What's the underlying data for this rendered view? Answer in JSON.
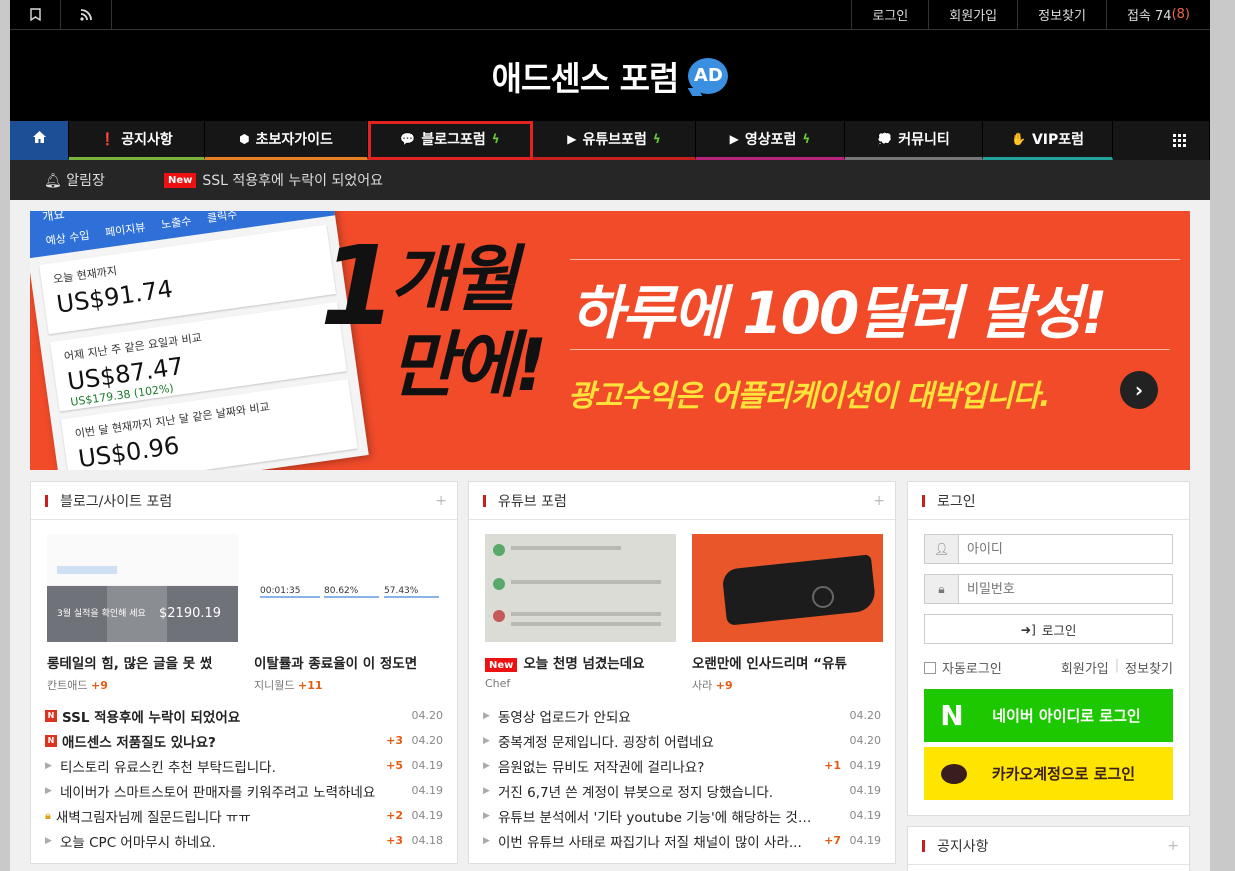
{
  "topbar": {
    "links": [
      "로그인",
      "회원가입",
      "정보찾기"
    ],
    "visitors_label": "접속 74",
    "visitors_new": "(8)"
  },
  "header": {
    "title": "애드센스 포럼",
    "badge": "AD"
  },
  "nav": {
    "items": [
      {
        "label": "공지사항",
        "icon": "info-icon",
        "color": "#7bb33a"
      },
      {
        "label": "초보자가이드",
        "icon": "cube-icon",
        "color": "#e67e22"
      },
      {
        "label": "블로그포럼",
        "icon": "chat-icon",
        "color": "#2a5db0"
      },
      {
        "label": "유튜브포럼",
        "icon": "youtube-icon",
        "color": "#c71e1e"
      },
      {
        "label": "영상포럼",
        "icon": "youtube-icon",
        "color": "#b8247c"
      },
      {
        "label": "커뮤니티",
        "icon": "comments-icon",
        "color": "#777777"
      },
      {
        "label": "VIP포럼",
        "icon": "hand-icon",
        "color": "#22a39b"
      }
    ]
  },
  "notice": {
    "label": "알림장",
    "badge": "New",
    "text": "SSL 적용후에 누락이 되었어요"
  },
  "banner": {
    "number": "1",
    "month": "개월",
    "month2": "만에!",
    "headline": "하루에 100달러 달성!",
    "sub": "광고수익은 어플리케이션이 대박입니다.",
    "phone_header": "개요",
    "phone_tabs": [
      "예상 수입",
      "페이지뷰",
      "노출수",
      "클릭수"
    ],
    "cards": [
      {
        "label": "오늘 현재까지",
        "value": "US$91.74",
        "growth": ""
      },
      {
        "label": "어제 지난 주 같은 요일과 비교",
        "value": "US$87.47",
        "growth": "US$179.38 (102%)"
      },
      {
        "label": "이번 달 현재까지 지난 달 같은 날짜와 비교",
        "value": "US$0.96",
        "growth": ""
      }
    ]
  },
  "blog_panel": {
    "title": "블로그/사이트 포럼",
    "thumbs": [
      {
        "title": "롱테일의 힘, 많은 글을 못 썼",
        "author": "칸트애드",
        "comments": "+9",
        "img_text": "$2190.19",
        "img_sub": "3월 실적을 확인해 세요"
      },
      {
        "title": "이탈률과 종료율이 이 정도면",
        "author": "지니월드",
        "comments": "+11",
        "stats": [
          "00:01:35",
          "80.62%",
          "57.43%"
        ]
      }
    ],
    "posts": [
      {
        "title": "SSL 적용후에 누락이 되었어요",
        "comments": "",
        "date": "04.20",
        "type": "new"
      },
      {
        "title": "애드센스 저품질도 있나요?",
        "comments": "+3",
        "date": "04.20",
        "type": "new"
      },
      {
        "title": "티스토리 유료스킨 추천 부탁드립니다.",
        "comments": "+5",
        "date": "04.19",
        "type": "normal"
      },
      {
        "title": "네이버가 스마트스토어 판매자를 키워주려고 노력하네요",
        "comments": "",
        "date": "04.19",
        "type": "normal"
      },
      {
        "title": "새벽그림자님께 질문드립니다 ㅠㅠ",
        "comments": "+2",
        "date": "04.19",
        "type": "lock"
      },
      {
        "title": "오늘 CPC 어마무시 하네요.",
        "comments": "+3",
        "date": "04.18",
        "type": "normal"
      }
    ]
  },
  "youtube_panel": {
    "title": "유튜브 포럼",
    "thumbs": [
      {
        "title": "오늘 천명 넘겼는데요",
        "author": "Chef",
        "comments": "",
        "badge": "New"
      },
      {
        "title": "오랜만에 인사드리며 “유튜",
        "author": "사라",
        "comments": "+9"
      }
    ],
    "posts": [
      {
        "title": "동영상 업로드가 안되요",
        "comments": "",
        "date": "04.20"
      },
      {
        "title": "중복계정 문제입니다. 굉장히 어렵네요",
        "comments": "",
        "date": "04.20"
      },
      {
        "title": "음원없는 뮤비도 저작권에 걸리나요?",
        "comments": "+1",
        "date": "04.19"
      },
      {
        "title": "거진 6,7년 쓴 계정이 뷰봇으로 정지 당했습니다.",
        "comments": "",
        "date": "04.19"
      },
      {
        "title": "유튜브 분석에서 '기타 youtube 기능'에 해당하는 것이 ...",
        "comments": "",
        "date": "04.19"
      },
      {
        "title": "이번 유튜브 사태로 짜집기나 저질 채널이 많이 사라...",
        "comments": "+7",
        "date": "04.19"
      }
    ]
  },
  "login_panel": {
    "title": "로그인",
    "id_placeholder": "아이디",
    "pw_placeholder": "비밀번호",
    "login_button": "로그인",
    "auto_login": "자동로그인",
    "signup": "회원가입",
    "find": "정보찾기",
    "naver": "네이버 아이디로 로그인",
    "naver_logo": "N",
    "kakao": "카카오계정으로 로그인"
  },
  "notice_panel": {
    "title": "공지사항"
  }
}
